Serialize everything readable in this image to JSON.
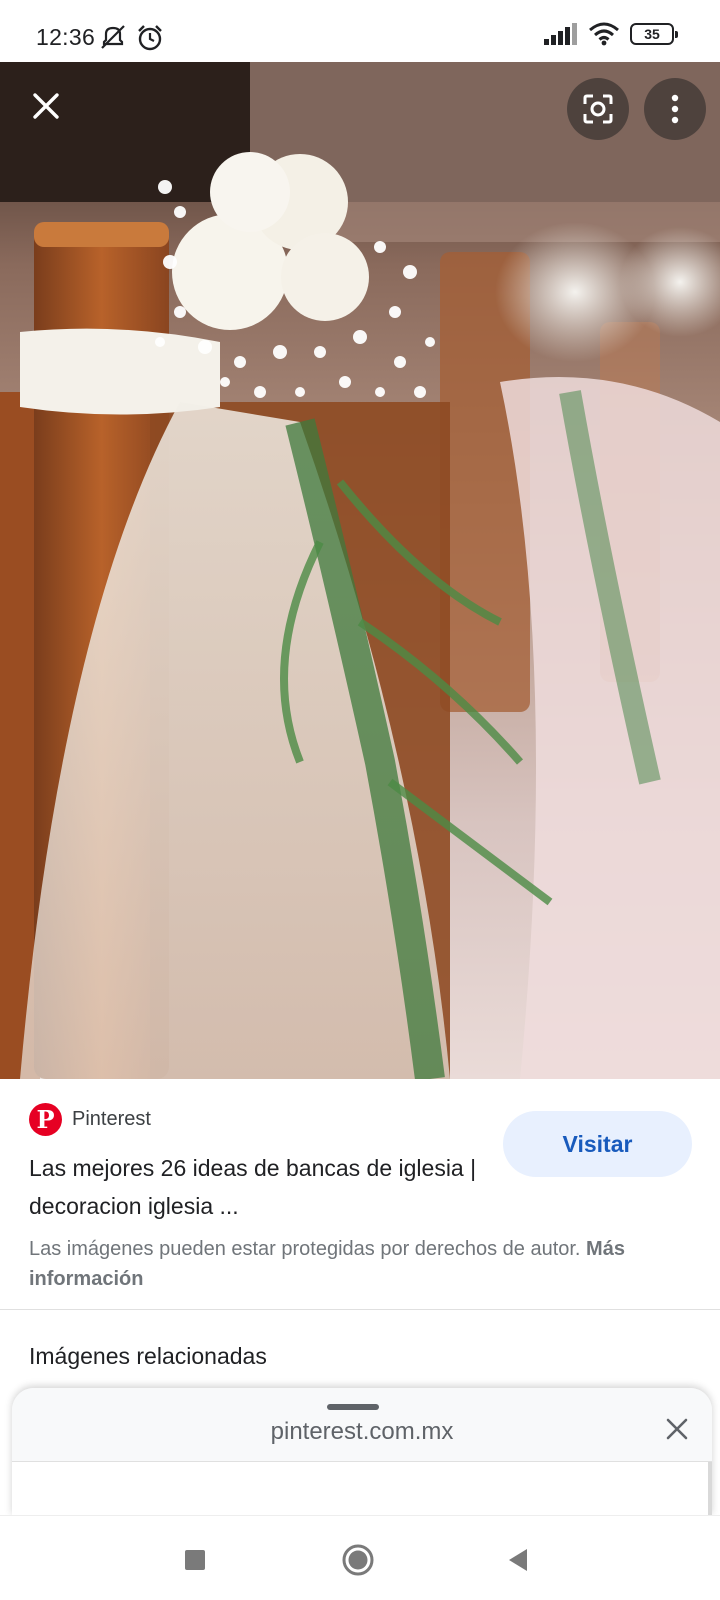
{
  "status_bar": {
    "time": "12:36",
    "battery": "35",
    "icons": [
      "mute-notifications-icon",
      "alarm-icon",
      "signal-icon",
      "wifi-icon",
      "battery-icon"
    ]
  },
  "viewer": {
    "close_icon": "close-icon",
    "lens_icon": "google-lens-icon",
    "more_icon": "more-vert-icon"
  },
  "result": {
    "source": "Pinterest",
    "source_logo_letter": "P",
    "visit_label": "Visitar",
    "title": "Las mejores 26 ideas de bancas de iglesia | decoracion iglesia ...",
    "copyright_text": "Las imágenes pueden estar protegidas por derechos de autor.",
    "copyright_link": "Más información",
    "related_title": "Imágenes relacionadas"
  },
  "sheet": {
    "url": "pinterest.com.mx"
  },
  "navbar": {
    "icons": [
      "recents-icon",
      "home-icon",
      "back-icon"
    ]
  },
  "colors": {
    "pinterest_red": "#e60023",
    "visit_bg": "#e8f0fe",
    "visit_text": "#185abc"
  }
}
